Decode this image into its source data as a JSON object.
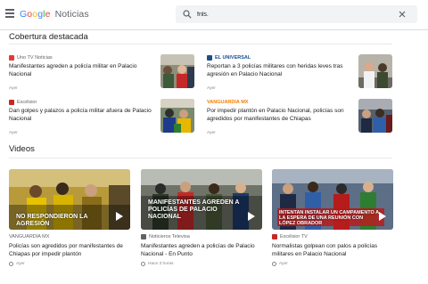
{
  "header": {
    "logo_google": [
      "G",
      "o",
      "o",
      "g",
      "l",
      "e"
    ],
    "logo_noticias": "Noticias",
    "search_value": "fnls."
  },
  "sections": {
    "featured_title": "Cobertura destacada",
    "videos_title": "Videos"
  },
  "featured": [
    {
      "source": "Uno TV Noticias",
      "headline": "Manifestantes agreden a policía militar en Palacio Nacional",
      "time": "Ayer",
      "source_color": "#e53935"
    },
    {
      "source": "EL UNIVERSAL",
      "headline": "Reportan a 3 policías militares con heridas leves tras agresión en Palacio Nacional",
      "time": "Ayer",
      "source_color": "#1a4f8b"
    },
    {
      "source": "Excélsior",
      "headline": "Dan golpes y palazos a policía militar afuera de Palacio Nacional",
      "time": "Ayer",
      "source_color": "#c62828"
    },
    {
      "source": "VANGUARDIA MX",
      "headline": "Por impedir plantón en Palacio Nacional, policías son agredidos por manifestantes de Chiapas",
      "time": "Ayer",
      "source_color": "#f57c00"
    }
  ],
  "videos": [
    {
      "caption": "NO RESPONDIERON LA AGRESIÓN",
      "source": "VANGUARDIA MX",
      "headline": "Policías son agredidos por manifestantes de Chiapas por impedir plantón",
      "time": "Ayer"
    },
    {
      "caption": "MANIFESTANTES AGREDEN A POLICÍAS DE PALACIO NACIONAL",
      "source": "Noticieros Televisa",
      "headline": "Manifestantes agreden a policías de Palacio Nacional - En Punto",
      "time": "Hace 3 horas"
    },
    {
      "caption": "INTENTAN INSTALAR UN CAMPAMENTO A LA ESPERA DE UNA REUNIÓN CON LÓPEZ OBRADOR",
      "source": "Excélsior TV",
      "headline": "Normalistas golpean con palos a policías militares en Palacio Nacional",
      "time": "Ayer"
    }
  ],
  "icons": {
    "menu": "menu-icon",
    "search": "search-icon",
    "clear": "close-icon",
    "play": "play-icon",
    "clock": "clock-icon"
  }
}
